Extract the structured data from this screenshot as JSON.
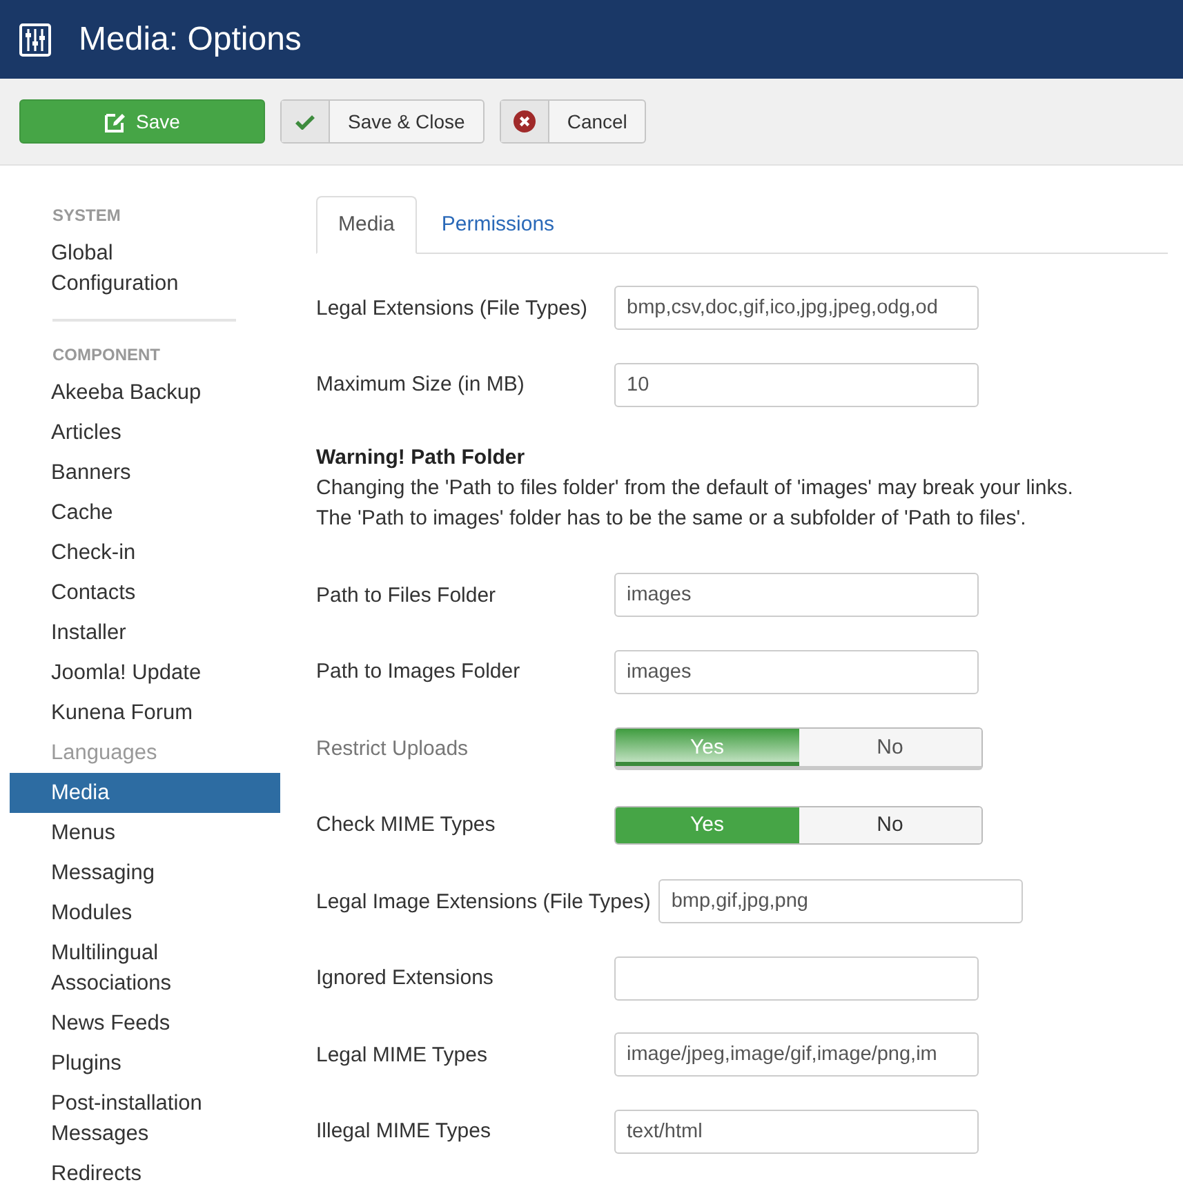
{
  "header": {
    "title": "Media: Options"
  },
  "toolbar": {
    "buttons": [
      {
        "label": "Save",
        "kind": "primary"
      },
      {
        "label": "Save & Close",
        "kind": "check"
      },
      {
        "label": "Cancel",
        "kind": "cancel"
      }
    ]
  },
  "sidebar": {
    "sections": [
      {
        "heading": "SYSTEM",
        "items": [
          {
            "label": "Global Configuration",
            "selected": false,
            "disabled": false
          }
        ]
      },
      {
        "heading": "COMPONENT",
        "items": [
          {
            "label": "Akeeba Backup",
            "selected": false,
            "disabled": false
          },
          {
            "label": "Articles",
            "selected": false,
            "disabled": false
          },
          {
            "label": "Banners",
            "selected": false,
            "disabled": false
          },
          {
            "label": "Cache",
            "selected": false,
            "disabled": false
          },
          {
            "label": "Check-in",
            "selected": false,
            "disabled": false
          },
          {
            "label": "Contacts",
            "selected": false,
            "disabled": false
          },
          {
            "label": "Installer",
            "selected": false,
            "disabled": false
          },
          {
            "label": "Joomla! Update",
            "selected": false,
            "disabled": false
          },
          {
            "label": "Kunena Forum",
            "selected": false,
            "disabled": false
          },
          {
            "label": "Languages",
            "selected": false,
            "disabled": true
          },
          {
            "label": "Media",
            "selected": true,
            "disabled": false
          },
          {
            "label": "Menus",
            "selected": false,
            "disabled": false
          },
          {
            "label": "Messaging",
            "selected": false,
            "disabled": false
          },
          {
            "label": "Modules",
            "selected": false,
            "disabled": false
          },
          {
            "label": "Multilingual Associations",
            "selected": false,
            "disabled": false
          },
          {
            "label": "News Feeds",
            "selected": false,
            "disabled": false
          },
          {
            "label": "Plugins",
            "selected": false,
            "disabled": false
          },
          {
            "label": "Post-installation Messages",
            "selected": false,
            "disabled": false
          },
          {
            "label": "Redirects",
            "selected": false,
            "disabled": false
          }
        ]
      }
    ]
  },
  "tabs": [
    {
      "label": "Media",
      "selected": true
    },
    {
      "label": "Permissions",
      "selected": false
    }
  ],
  "form": {
    "items": [
      {
        "kind": "text",
        "label": "Legal Extensions (File Types)",
        "value": "bmp,csv,doc,gif,ico,jpg,jpeg,odg,od",
        "disabled": false
      },
      {
        "kind": "text",
        "label": "Maximum Size (in MB)",
        "value": "10",
        "disabled": false
      },
      {
        "kind": "note",
        "title": "Warning! Path Folder",
        "lines": [
          "Changing the 'Path to files folder' from the default of 'images' may break your links.",
          "The 'Path to images' folder has to be the same or a subfolder of 'Path to files'."
        ]
      },
      {
        "kind": "text",
        "label": "Path to Files Folder",
        "value": "images",
        "disabled": false
      },
      {
        "kind": "text",
        "label": "Path to Images Folder",
        "value": "images",
        "disabled": false
      },
      {
        "kind": "toggle",
        "label": "Restrict Uploads",
        "disabled": true,
        "options": [
          {
            "label": "Yes",
            "selected": true
          },
          {
            "label": "No",
            "selected": false
          }
        ]
      },
      {
        "kind": "toggle",
        "label": "Check MIME Types",
        "disabled": false,
        "options": [
          {
            "label": "Yes",
            "selected": true
          },
          {
            "label": "No",
            "selected": false
          }
        ]
      },
      {
        "kind": "text",
        "label": "Legal Image Extensions (File Types)",
        "value": "bmp,gif,jpg,png",
        "disabled": false
      },
      {
        "kind": "text",
        "label": "Ignored Extensions",
        "disabled": false
      },
      {
        "kind": "text",
        "label": "Legal MIME Types",
        "value": "image/jpeg,image/gif,image/png,im",
        "disabled": false
      },
      {
        "kind": "text",
        "label": "Illegal MIME Types",
        "value": "text/html",
        "disabled": false
      }
    ]
  }
}
